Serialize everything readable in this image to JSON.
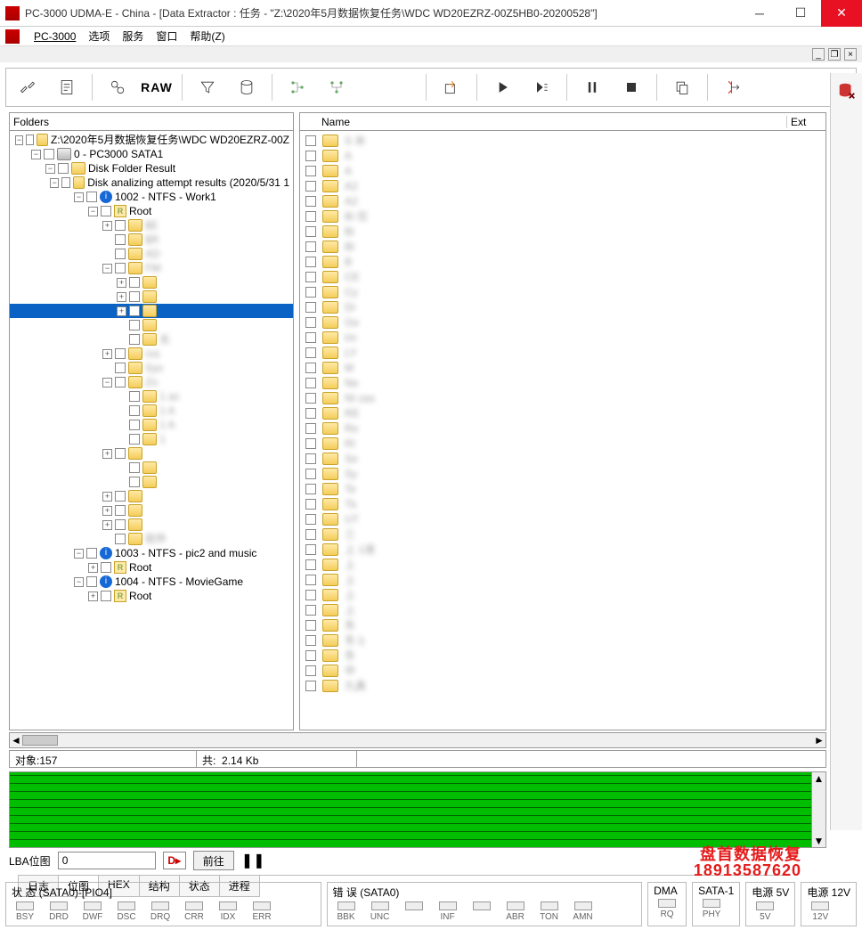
{
  "window": {
    "title": "PC-3000 UDMA-E - China - [Data Extractor : 任务 - \"Z:\\2020年5月数据恢复任务\\WDC WD20EZRZ-00Z5HB0-20200528\"]"
  },
  "menu": {
    "pc3000": "PC-3000",
    "options": "选项",
    "services": "服务",
    "window": "窗口",
    "help": "帮助(Z)"
  },
  "toolbar": {
    "raw": "RAW"
  },
  "panes": {
    "folders_header": "Folders",
    "name_header": "Name",
    "ext_header": "Ext"
  },
  "tree": [
    {
      "d": 0,
      "tw": "-",
      "chk": true,
      "ico": "folder",
      "label": "Z:\\2020年5月数据恢复任务\\WDC WD20EZRZ-00Z"
    },
    {
      "d": 1,
      "tw": "-",
      "chk": true,
      "ico": "drive",
      "label": "0 - PC3000 SATA1"
    },
    {
      "d": 2,
      "tw": "-",
      "chk": true,
      "ico": "folder",
      "label": "Disk Folder Result"
    },
    {
      "d": 3,
      "tw": "-",
      "chk": true,
      "ico": "folder",
      "label": "Disk analizing attempt results (2020/5/31 1"
    },
    {
      "d": 4,
      "tw": "-",
      "chk": true,
      "ico": "info",
      "label": "1002 - NTFS - Work1"
    },
    {
      "d": 5,
      "tw": "-",
      "chk": true,
      "ico": "r",
      "label": "Root"
    },
    {
      "d": 6,
      "tw": "+",
      "chk": true,
      "ico": "folder",
      "label": "$E",
      "blur": true
    },
    {
      "d": 6,
      "tw": " ",
      "chk": true,
      "ico": "folder",
      "label": "$R",
      "blur": true
    },
    {
      "d": 6,
      "tw": " ",
      "chk": true,
      "ico": "folder",
      "label": "AD",
      "blur": true
    },
    {
      "d": 6,
      "tw": "-",
      "chk": true,
      "ico": "folder",
      "label": "FM",
      "blur": true
    },
    {
      "d": 7,
      "tw": "+",
      "chk": true,
      "ico": "folder",
      "label": "",
      "blur": true
    },
    {
      "d": 7,
      "tw": "+",
      "chk": true,
      "ico": "folder",
      "label": "",
      "blur": true
    },
    {
      "d": 7,
      "tw": "+",
      "chk": true,
      "ico": "folder",
      "label": "",
      "blur": true,
      "selected": true
    },
    {
      "d": 7,
      "tw": " ",
      "chk": true,
      "ico": "folder",
      "label": "",
      "blur": true
    },
    {
      "d": 7,
      "tw": " ",
      "chk": true,
      "ico": "folder",
      "label": "长",
      "blur": true
    },
    {
      "d": 6,
      "tw": "+",
      "chk": true,
      "ico": "folder",
      "label": "ros",
      "blur": true
    },
    {
      "d": 6,
      "tw": " ",
      "chk": true,
      "ico": "folder",
      "label": "Sys",
      "blur": true
    },
    {
      "d": 6,
      "tw": "-",
      "chk": true,
      "ico": "folder",
      "label": "Zo",
      "blur": true
    },
    {
      "d": 7,
      "tw": " ",
      "chk": true,
      "ico": "folder",
      "label": "1      ac",
      "blur": true
    },
    {
      "d": 7,
      "tw": " ",
      "chk": true,
      "ico": "folder",
      "label": "1      A",
      "blur": true
    },
    {
      "d": 7,
      "tw": " ",
      "chk": true,
      "ico": "folder",
      "label": "1      A",
      "blur": true
    },
    {
      "d": 7,
      "tw": " ",
      "chk": true,
      "ico": "folder",
      "label": "1",
      "blur": true
    },
    {
      "d": 6,
      "tw": "+",
      "chk": true,
      "ico": "folder",
      "label": "",
      "blur": true
    },
    {
      "d": 7,
      "tw": " ",
      "chk": true,
      "ico": "folder",
      "label": "",
      "blur": true
    },
    {
      "d": 7,
      "tw": " ",
      "chk": true,
      "ico": "folder",
      "label": "",
      "blur": true
    },
    {
      "d": 6,
      "tw": "+",
      "chk": true,
      "ico": "folder",
      "label": "",
      "blur": true
    },
    {
      "d": 6,
      "tw": "+",
      "chk": true,
      "ico": "folder",
      "label": "",
      "blur": true
    },
    {
      "d": 6,
      "tw": "+",
      "chk": true,
      "ico": "folder",
      "label": "",
      "blur": true
    },
    {
      "d": 6,
      "tw": " ",
      "chk": true,
      "ico": "folder",
      "label": "软件",
      "blur": true
    },
    {
      "d": 4,
      "tw": "-",
      "chk": true,
      "ico": "info",
      "label": "1003 - NTFS - pic2 and music"
    },
    {
      "d": 5,
      "tw": "+",
      "chk": true,
      "ico": "r",
      "label": "Root"
    },
    {
      "d": 4,
      "tw": "-",
      "chk": true,
      "ico": "info",
      "label": "1004 - NTFS - MovieGame"
    },
    {
      "d": 5,
      "tw": "+",
      "chk": true,
      "ico": "r",
      "label": "Root"
    }
  ],
  "files": [
    {
      "label": "S                米",
      "blur": true
    },
    {
      "label": "A",
      "blur": true
    },
    {
      "label": "A",
      "blur": true
    },
    {
      "label": "A2",
      "blur": true
    },
    {
      "label": "A2",
      "blur": true
    },
    {
      "label": "Bi                    仅",
      "blur": true
    },
    {
      "label": "Bi",
      "blur": true
    },
    {
      "label": "Bl",
      "blur": true
    },
    {
      "label": "B",
      "blur": true
    },
    {
      "label": "CE",
      "blur": true
    },
    {
      "label": "Cy",
      "blur": true
    },
    {
      "label": "Dr",
      "blur": true
    },
    {
      "label": "Ge",
      "blur": true
    },
    {
      "label": "Im",
      "blur": true
    },
    {
      "label": "LY",
      "blur": true
    },
    {
      "label": "M",
      "blur": true
    },
    {
      "label": "Ne",
      "blur": true
    },
    {
      "label": "NI                         zas",
      "blur": true
    },
    {
      "label": "RE",
      "blur": true
    },
    {
      "label": "Re",
      "blur": true
    },
    {
      "label": "RI",
      "blur": true
    },
    {
      "label": "Se",
      "blur": true
    },
    {
      "label": "Sy",
      "blur": true
    },
    {
      "label": "Te",
      "blur": true
    },
    {
      "label": "Tk",
      "blur": true
    },
    {
      "label": "UT",
      "blur": true
    },
    {
      "label": "三",
      "blur": true
    },
    {
      "label": "上                  1液",
      "blur": true
    },
    {
      "label": "上",
      "blur": true
    },
    {
      "label": "上",
      "blur": true
    },
    {
      "label": "上",
      "blur": true
    },
    {
      "label": "上",
      "blur": true
    },
    {
      "label": "东",
      "blur": true
    },
    {
      "label": "东               i)",
      "blur": true
    },
    {
      "label": "东",
      "blur": true
    },
    {
      "label": "中",
      "blur": true
    },
    {
      "label": "九真",
      "blur": true
    }
  ],
  "status": {
    "objects_label": "对象:",
    "objects_value": "157",
    "total_label": "共:",
    "total_value": "2.14 Kb"
  },
  "lba": {
    "label": "LBA位图",
    "value": "0",
    "goto": "前往"
  },
  "watermark": {
    "line1": "盘首数据恢复",
    "line2": "18913587620"
  },
  "tabs": {
    "log": "日志",
    "bitmap": "位图",
    "hex": "HEX",
    "struct": "结构",
    "state": "状态",
    "progress": "进程"
  },
  "bottom": {
    "state_title": "状 态 (SATA0)-[PIO4]",
    "error_title": "错 误 (SATA0)",
    "dma_title": "DMA",
    "sata_title": "SATA-1",
    "pwr5_title": "电源 5V",
    "pwr12_title": "电源 12V",
    "state_leds": [
      "BSY",
      "DRD",
      "DWF",
      "DSC",
      "DRQ",
      "CRR",
      "IDX",
      "ERR"
    ],
    "error_leds": [
      "BBK",
      "UNC",
      "",
      "INF",
      "",
      "ABR",
      "TON",
      "AMN"
    ],
    "dma_led": "RQ",
    "sata_led": "PHY",
    "pwr5_led": "5V",
    "pwr12_led": "12V"
  }
}
